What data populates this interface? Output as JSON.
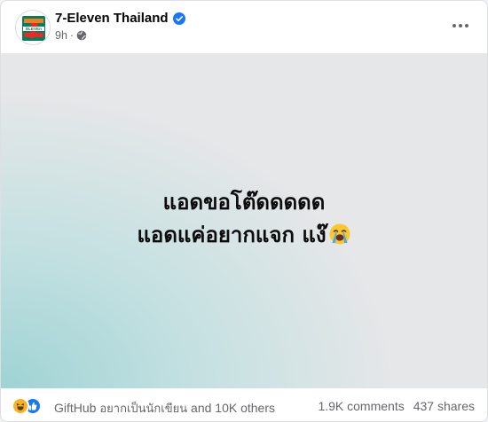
{
  "post": {
    "page_name": "7-Eleven Thailand",
    "time": "9h",
    "separator": "·",
    "audience_icon": "globe-icon",
    "verified_icon": "verified-badge-icon",
    "logo_text": "ELEVEn",
    "text_line1": "แอดขอโต๊ดดดดด",
    "text_line2": "แอดแค่อยากแจก แง๊",
    "emoji": "loudly-crying-face"
  },
  "footer": {
    "reactions": [
      "haha",
      "like"
    ],
    "reactor_name": "GiftHub",
    "reactor_thai": "อยากเป็นนักเขียน",
    "reactor_rest": "and 10K others",
    "comments": "1.9K comments",
    "shares": "437 shares"
  },
  "colors": {
    "brand_green": "#008061",
    "brand_orange": "#f47d20",
    "brand_red": "#ee2724",
    "verified_blue": "#1877f2",
    "media_teal": "#9fd3d4",
    "media_gray": "#e6e7e8"
  }
}
